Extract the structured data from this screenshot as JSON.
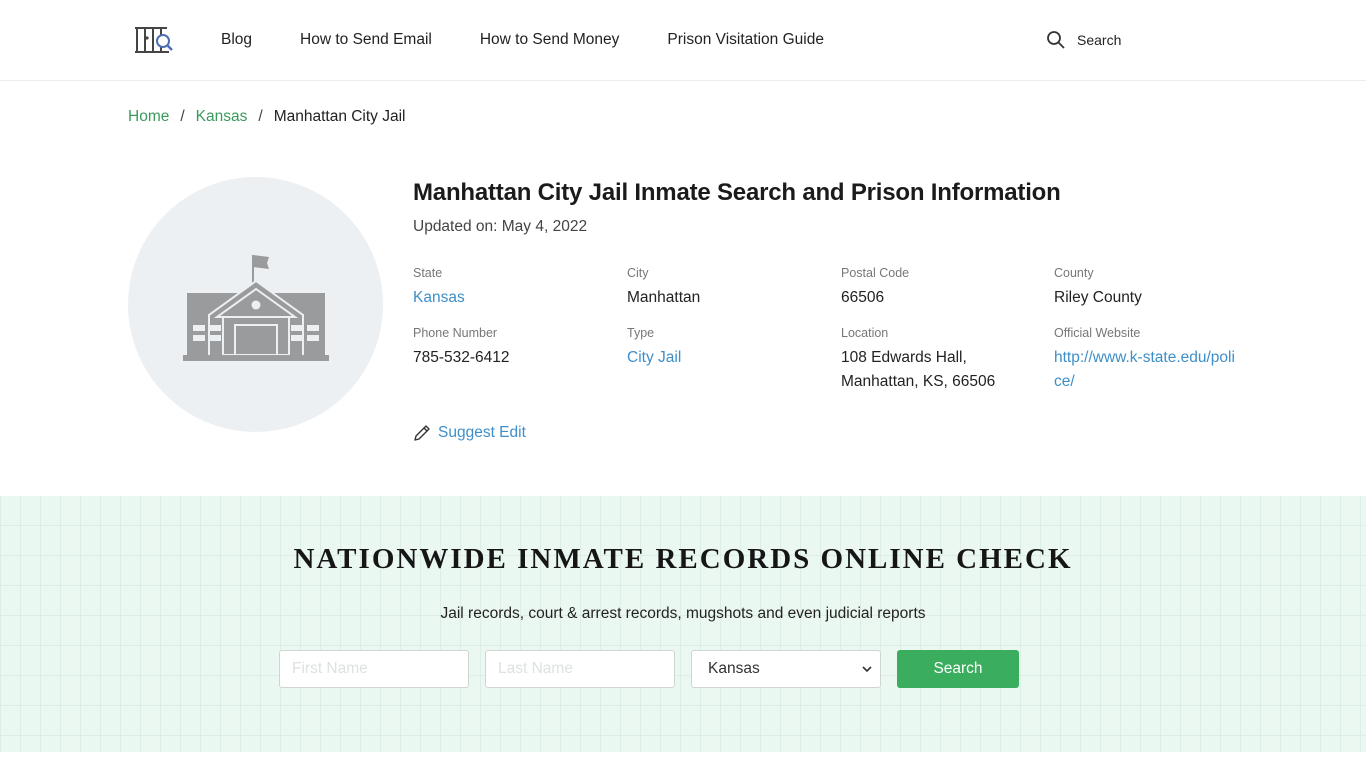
{
  "header": {
    "logo_icon": "jail-bars-search-icon",
    "nav": [
      {
        "label": "Blog"
      },
      {
        "label": "How to Send Email"
      },
      {
        "label": "How to Send Money"
      },
      {
        "label": "Prison Visitation Guide"
      }
    ],
    "search_label": "Search"
  },
  "breadcrumb": {
    "items": [
      {
        "label": "Home"
      },
      {
        "label": "Kansas"
      }
    ],
    "separator": "/",
    "current": "Manhattan City Jail"
  },
  "facility": {
    "image_icon": "building-icon",
    "title": "Manhattan City Jail Inmate Search and Prison Information",
    "updated": "Updated on: May 4, 2022",
    "details": {
      "state": {
        "label": "State",
        "value": "Kansas"
      },
      "city": {
        "label": "City",
        "value": "Manhattan"
      },
      "postal_code": {
        "label": "Postal Code",
        "value": "66506"
      },
      "county": {
        "label": "County",
        "value": "Riley County"
      },
      "phone": {
        "label": "Phone Number",
        "value": "785-532-6412"
      },
      "type": {
        "label": "Type",
        "value": "City Jail"
      },
      "location": {
        "label": "Location",
        "line1": "108 Edwards Hall,",
        "line2": "Manhattan, KS, 66506"
      },
      "website": {
        "label": "Official Website",
        "value": "http://www.k-state.edu/police/"
      }
    },
    "suggest_edit": "Suggest Edit"
  },
  "search_section": {
    "title": "NATIONWIDE INMATE RECORDS ONLINE CHECK",
    "subtitle": "Jail records, court & arrest records, mugshots and even judicial reports",
    "first_name_placeholder": "First Name",
    "last_name_placeholder": "Last Name",
    "state_selected": "Kansas",
    "button_label": "Search"
  },
  "colors": {
    "breadcrumb_link": "#3a9a5c",
    "link": "#3e8fc9",
    "search_button": "#3aad5f",
    "section_bg": "#ebf8f1"
  }
}
